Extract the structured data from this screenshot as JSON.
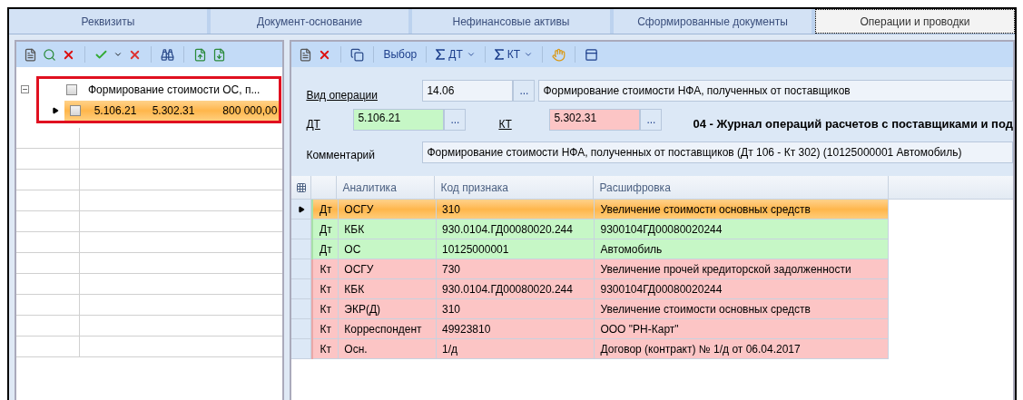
{
  "tabs": [
    {
      "label": "Реквизиты",
      "selected": false
    },
    {
      "label": "Документ-основание",
      "selected": false
    },
    {
      "label": "Нефинансовые активы",
      "selected": false
    },
    {
      "label": "Сформированные документы",
      "selected": false
    },
    {
      "label": "Операции и проводки",
      "selected": true
    }
  ],
  "tree": {
    "label": "Формирование  стоимости  ОС,  п...",
    "checked": false,
    "expanded": true,
    "children": [
      {
        "dt": "5.106.21",
        "kt": "5.302.31",
        "amount": "800 000,00",
        "checked": false,
        "selected": true
      }
    ]
  },
  "right_toolbar": {
    "choose": "Выбор",
    "dt": "ДТ",
    "kt": "КТ"
  },
  "form": {
    "operation_label": "Вид операции",
    "operation_code": "14.06",
    "operation_name": "Формирование стоимости НФА, полученных от поставщиков",
    "operation_button": "...",
    "dt_button": "...",
    "kt_button": "...",
    "dt_label": "ДТ",
    "dt_value": "5.106.21",
    "kt_label": "КТ",
    "kt_value": "5.302.31",
    "journal": "04 - Журнал операций расчетов с поставщиками и под",
    "comment_label": "Комментарий",
    "comment_value": "Формирование стоимости НФА, полученных от поставщиков (Дт 106 - Кт 302) (10125000001 Автомобиль)"
  },
  "table": {
    "columns": [
      "Аналитика",
      "Код признака",
      "Расшифровка"
    ],
    "rows": [
      {
        "kind": "debit",
        "selected": true,
        "side": "Дт",
        "analytic": "ОСГУ",
        "code": "310",
        "decoding": "Увеличение стоимости основных средств"
      },
      {
        "kind": "debit",
        "selected": false,
        "side": "Дт",
        "analytic": "КБК",
        "code": "930.0104.ГД00080020.244",
        "decoding": "9300104ГД00080020244"
      },
      {
        "kind": "debit",
        "selected": false,
        "side": "Дт",
        "analytic": "ОС",
        "code": "10125000001",
        "decoding": "Автомобиль"
      },
      {
        "kind": "credit",
        "selected": false,
        "side": "Кт",
        "analytic": "ОСГУ",
        "code": "730",
        "decoding": "Увеличение прочей кредиторской задолженности"
      },
      {
        "kind": "credit",
        "selected": false,
        "side": "Кт",
        "analytic": "КБК",
        "code": "930.0104.ГД00080020.244",
        "decoding": "9300104ГД00080020244"
      },
      {
        "kind": "credit",
        "selected": false,
        "side": "Кт",
        "analytic": "ЭКР(Д)",
        "code": "310",
        "decoding": "Увеличение стоимости основных средств"
      },
      {
        "kind": "credit",
        "selected": false,
        "side": "Кт",
        "analytic": "Корреспондент",
        "code": "49923810",
        "decoding": "ООО \"РН-Карт\""
      },
      {
        "kind": "credit",
        "selected": false,
        "side": "Кт",
        "analytic": "Осн.",
        "code": "1/д",
        "decoding": "Договор (контракт) № 1/д от 06.04.2017"
      }
    ]
  }
}
